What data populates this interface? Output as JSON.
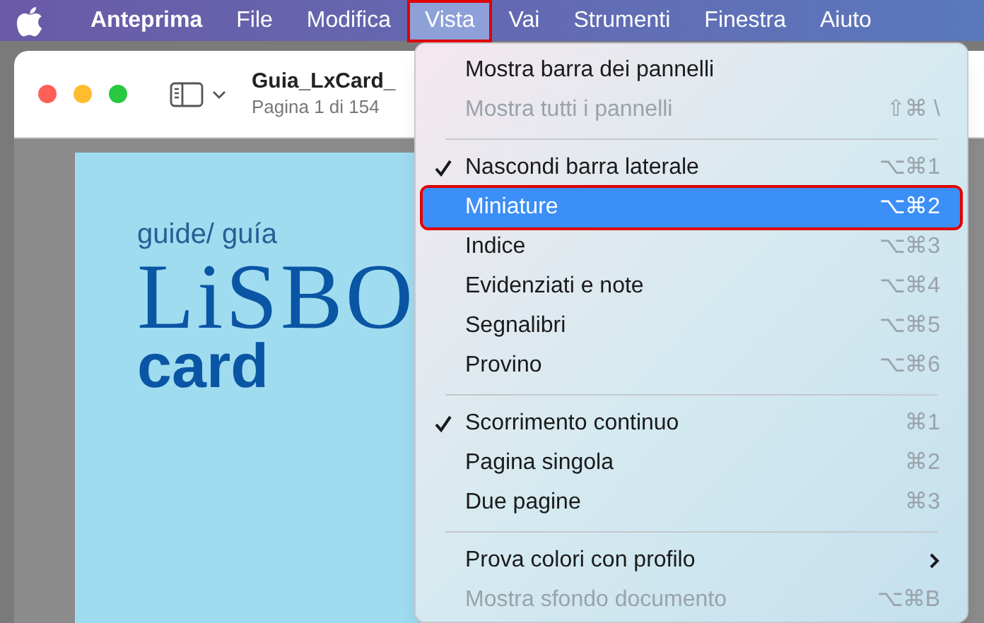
{
  "menu_bar": [
    {
      "label": "Anteprima",
      "bold": true,
      "selected": false,
      "outlined": false
    },
    {
      "label": "File",
      "bold": false,
      "selected": false,
      "outlined": false
    },
    {
      "label": "Modifica",
      "bold": false,
      "selected": false,
      "outlined": false
    },
    {
      "label": "Vista",
      "bold": false,
      "selected": true,
      "outlined": true
    },
    {
      "label": "Vai",
      "bold": false,
      "selected": false,
      "outlined": false
    },
    {
      "label": "Strumenti",
      "bold": false,
      "selected": false,
      "outlined": false
    },
    {
      "label": "Finestra",
      "bold": false,
      "selected": false,
      "outlined": false
    },
    {
      "label": "Aiuto",
      "bold": false,
      "selected": false,
      "outlined": false
    }
  ],
  "window": {
    "title": "Guia_LxCard_",
    "subtitle": "Pagina 1 di 154"
  },
  "document": {
    "kicker": "guide/ guía",
    "logo": "LiSBO",
    "logo_sub": "card"
  },
  "menu": [
    {
      "kind": "item",
      "label": "Mostra barra dei pannelli",
      "checked": false,
      "disabled": false,
      "selected": false,
      "outlined": false
    },
    {
      "kind": "item",
      "label": "Mostra tutti i pannelli",
      "shortcut": "⇧⌘ \\",
      "checked": false,
      "disabled": true,
      "selected": false,
      "outlined": false
    },
    {
      "kind": "separator"
    },
    {
      "kind": "item",
      "label": "Nascondi barra laterale",
      "shortcut": "⌥⌘1",
      "checked": true,
      "disabled": false,
      "selected": false,
      "outlined": false
    },
    {
      "kind": "item",
      "label": "Miniature",
      "shortcut": "⌥⌘2",
      "checked": false,
      "disabled": false,
      "selected": true,
      "outlined": true
    },
    {
      "kind": "item",
      "label": "Indice",
      "shortcut": "⌥⌘3",
      "checked": false,
      "disabled": false,
      "selected": false,
      "outlined": false
    },
    {
      "kind": "item",
      "label": "Evidenziati e note",
      "shortcut": "⌥⌘4",
      "checked": false,
      "disabled": false,
      "selected": false,
      "outlined": false
    },
    {
      "kind": "item",
      "label": "Segnalibri",
      "shortcut": "⌥⌘5",
      "checked": false,
      "disabled": false,
      "selected": false,
      "outlined": false
    },
    {
      "kind": "item",
      "label": "Provino",
      "shortcut": "⌥⌘6",
      "checked": false,
      "disabled": false,
      "selected": false,
      "outlined": false
    },
    {
      "kind": "separator"
    },
    {
      "kind": "item",
      "label": "Scorrimento continuo",
      "shortcut": "⌘1",
      "checked": true,
      "disabled": false,
      "selected": false,
      "outlined": false
    },
    {
      "kind": "item",
      "label": "Pagina singola",
      "shortcut": "⌘2",
      "checked": false,
      "disabled": false,
      "selected": false,
      "outlined": false
    },
    {
      "kind": "item",
      "label": "Due pagine",
      "shortcut": "⌘3",
      "checked": false,
      "disabled": false,
      "selected": false,
      "outlined": false
    },
    {
      "kind": "separator"
    },
    {
      "kind": "item",
      "label": "Prova colori con profilo",
      "submenu": true,
      "checked": false,
      "disabled": false,
      "selected": false,
      "outlined": false
    },
    {
      "kind": "item",
      "label": "Mostra sfondo documento",
      "shortcut": "⌥⌘B",
      "checked": false,
      "disabled": true,
      "selected": false,
      "outlined": false
    }
  ]
}
